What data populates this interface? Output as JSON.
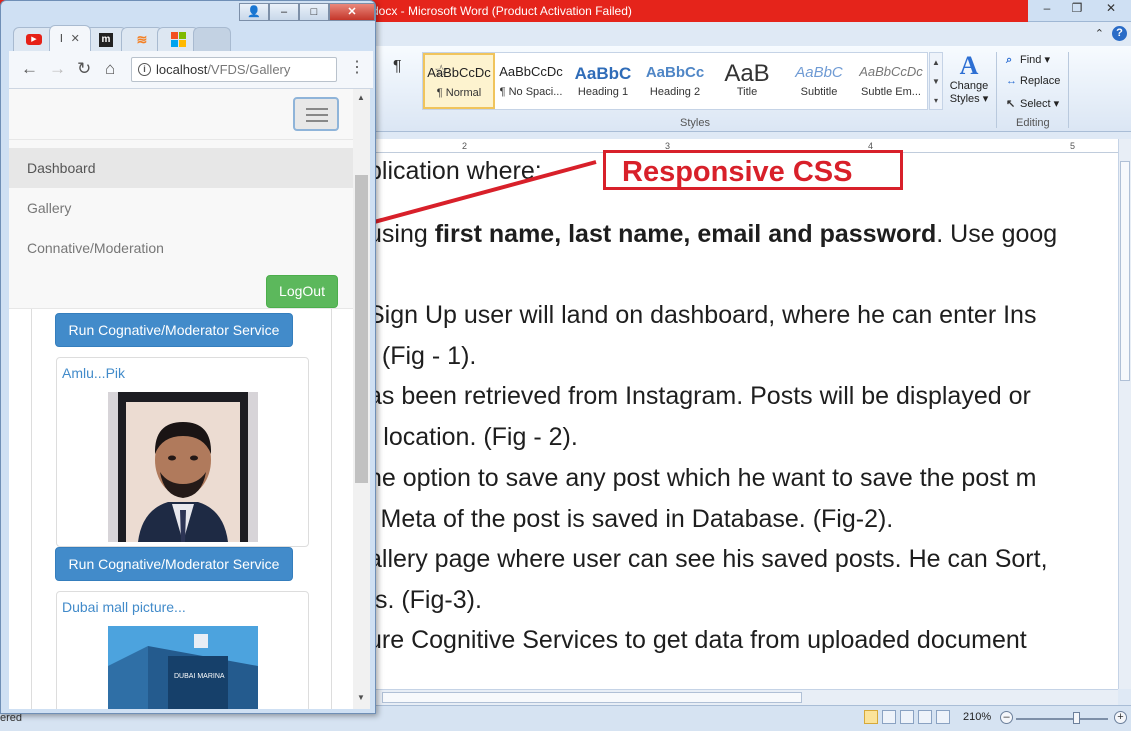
{
  "word": {
    "title": "docx - Microsoft Word (Product Activation Failed)",
    "window_controls": [
      "–",
      "❐",
      "✕"
    ],
    "styles": [
      {
        "preview": "AaBbCcDc",
        "name": "¶ Normal",
        "selected": true
      },
      {
        "preview": "AaBbCcDc",
        "name": "¶ No Spaci..."
      },
      {
        "preview": "AaBbC",
        "name": "Heading 1"
      },
      {
        "preview": "AaBbCc",
        "name": "Heading 2"
      },
      {
        "preview": "AaB",
        "name": "Title"
      },
      {
        "preview": "AaBbC",
        "name": "Subtitle"
      },
      {
        "preview": "AaBbCcDc",
        "name": "Subtle Em..."
      }
    ],
    "change_styles": {
      "line1": "Change",
      "line2": "Styles ▾"
    },
    "editing": {
      "find": "Find ▾",
      "replace": "Replace",
      "select": "Select ▾"
    },
    "groups": {
      "styles": "Styles",
      "editing": "Editing"
    },
    "ruler": [
      "2",
      "3",
      "4",
      "5"
    ],
    "doc_lines": {
      "l1": "plication where:",
      "l2_pre": "using ",
      "l2_bold": "first name, last name, email and password",
      "l2_post": ". Use goog",
      "l3": "Sign Up user will land on dashboard, where he can enter Ins",
      "l4": ". (Fig - 1).",
      "l5": "as been retrieved from Instagram. Posts will be displayed or",
      "l6": "r location. (Fig - 2).",
      "l7": "he option to save any post which he want to save the post m",
      "l8": "l Meta of the post is saved in Database. (Fig-2).",
      "l9": "allery page where user can see his saved posts. He can Sort,",
      "l10": "ts. (Fig-3).",
      "l11": "ure Cognitive Services to get data from uploaded document"
    },
    "status_left": "ered",
    "zoom": "210%"
  },
  "annotation": {
    "label": "Responsive CSS",
    "color": "#d8202a"
  },
  "browser": {
    "url_host": "localhost",
    "url_path": "/VFDS/Gallery",
    "active_tab": "l",
    "nav": {
      "dashboard": "Dashboard",
      "gallery": "Gallery",
      "moderation": "Connative/Moderation",
      "logout": "LogOut"
    },
    "run_button": "Run Cognative/Moderator Service",
    "cards": [
      {
        "title": "Amlu...Pik"
      },
      {
        "title": "Dubai mall picture..."
      }
    ],
    "colors": {
      "primary": "#428bca",
      "success": "#5cb85c"
    }
  }
}
